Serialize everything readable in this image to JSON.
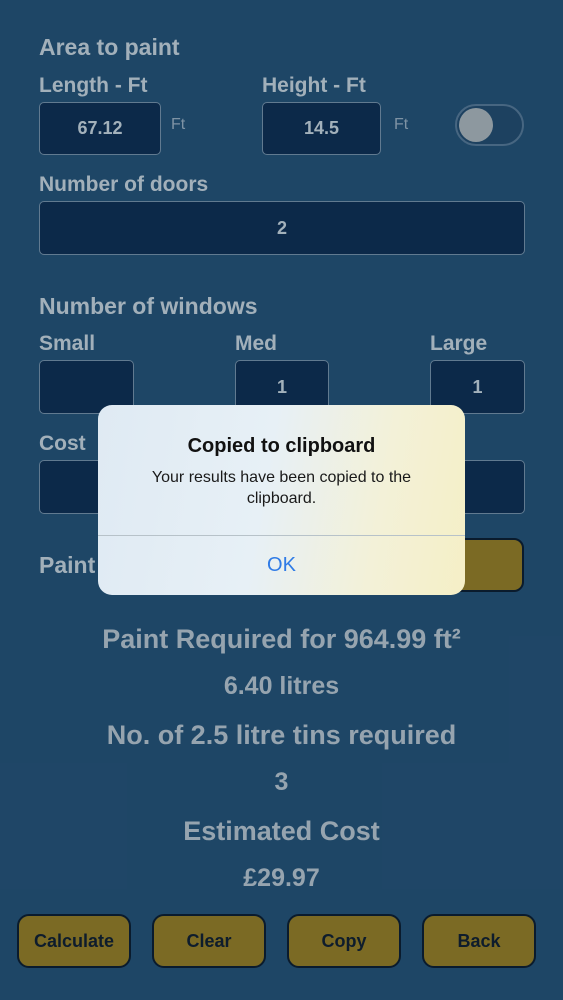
{
  "area": {
    "title": "Area to paint",
    "length_label": "Length - Ft",
    "height_label": "Height - Ft",
    "length_value": "67.12",
    "height_value": "14.5",
    "length_unit": "Ft",
    "height_unit": "Ft",
    "units_toggle_on": false
  },
  "doors": {
    "label": "Number of doors",
    "value": "2"
  },
  "windows": {
    "title": "Number of windows",
    "small_label": "Small",
    "med_label": "Med",
    "large_label": "Large",
    "small_value": "",
    "med_value": "1",
    "large_value": "1"
  },
  "cost": {
    "label_partial": "Cost",
    "value": ""
  },
  "paint": {
    "label_partial": "Paint"
  },
  "results": {
    "area_line": "Paint Required for 964.99 ft²",
    "litres": "6.40 litres",
    "tins_label": "No. of 2.5 litre tins required",
    "tins_value": "3",
    "cost_label": "Estimated Cost",
    "cost_value": "£29.97"
  },
  "buttons": {
    "calculate": "Calculate",
    "clear": "Clear",
    "copy": "Copy",
    "back": "Back"
  },
  "alert": {
    "title": "Copied to clipboard",
    "message": "Your results have been copied to the clipboard.",
    "ok": "OK"
  },
  "colors": {
    "background": "#204a6d",
    "field": "#0c2a4c",
    "button": "#8a7421",
    "alert_link": "#2f7be6"
  }
}
